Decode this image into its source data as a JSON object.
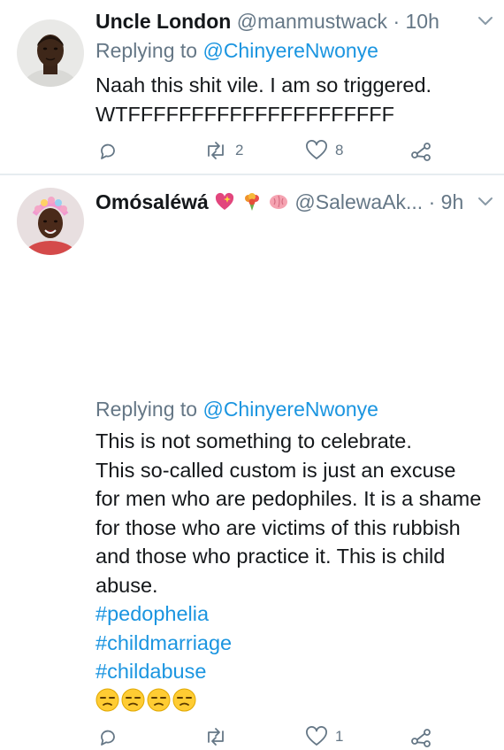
{
  "tweets": [
    {
      "name": "Uncle London",
      "handle": "@manmustwack",
      "dot": "·",
      "time": "10h",
      "replying_prefix": "Replying to",
      "replying_to": "@ChinyereNwonye",
      "lines": [
        "Naah this shit vile. I am so triggered.",
        "WTFFFFFFFFFFFFFFFFFFFFF"
      ],
      "retweets": "2",
      "likes": "8"
    },
    {
      "name": "Omósaléwá",
      "name_emoji": [
        "sparkling-heart-emoji",
        "bouquet-emoji",
        "brain-emoji"
      ],
      "handle": "@SalewaAk...",
      "dot": "·",
      "time": "9h",
      "replying_prefix": "Replying to",
      "replying_to": "@ChinyereNwonye",
      "lines": [
        "This is not something to celebrate.",
        "This so-called custom is just an excuse",
        "for men who are pedophiles. It is a shame",
        "for those who are victims of this rubbish",
        "and those who practice it. This is child",
        "abuse."
      ],
      "hashtags": [
        "#pedophelia",
        "#childmarriage",
        "#childabuse"
      ],
      "emoji": [
        "unamused-face-emoji",
        "unamused-face-emoji",
        "unamused-face-emoji",
        "unamused-face-emoji"
      ],
      "retweets": "",
      "likes": "1"
    }
  ],
  "colors": {
    "text": "#14171a",
    "muted": "#657786",
    "link": "#1b95e0",
    "separator": "#e6ecf0"
  }
}
